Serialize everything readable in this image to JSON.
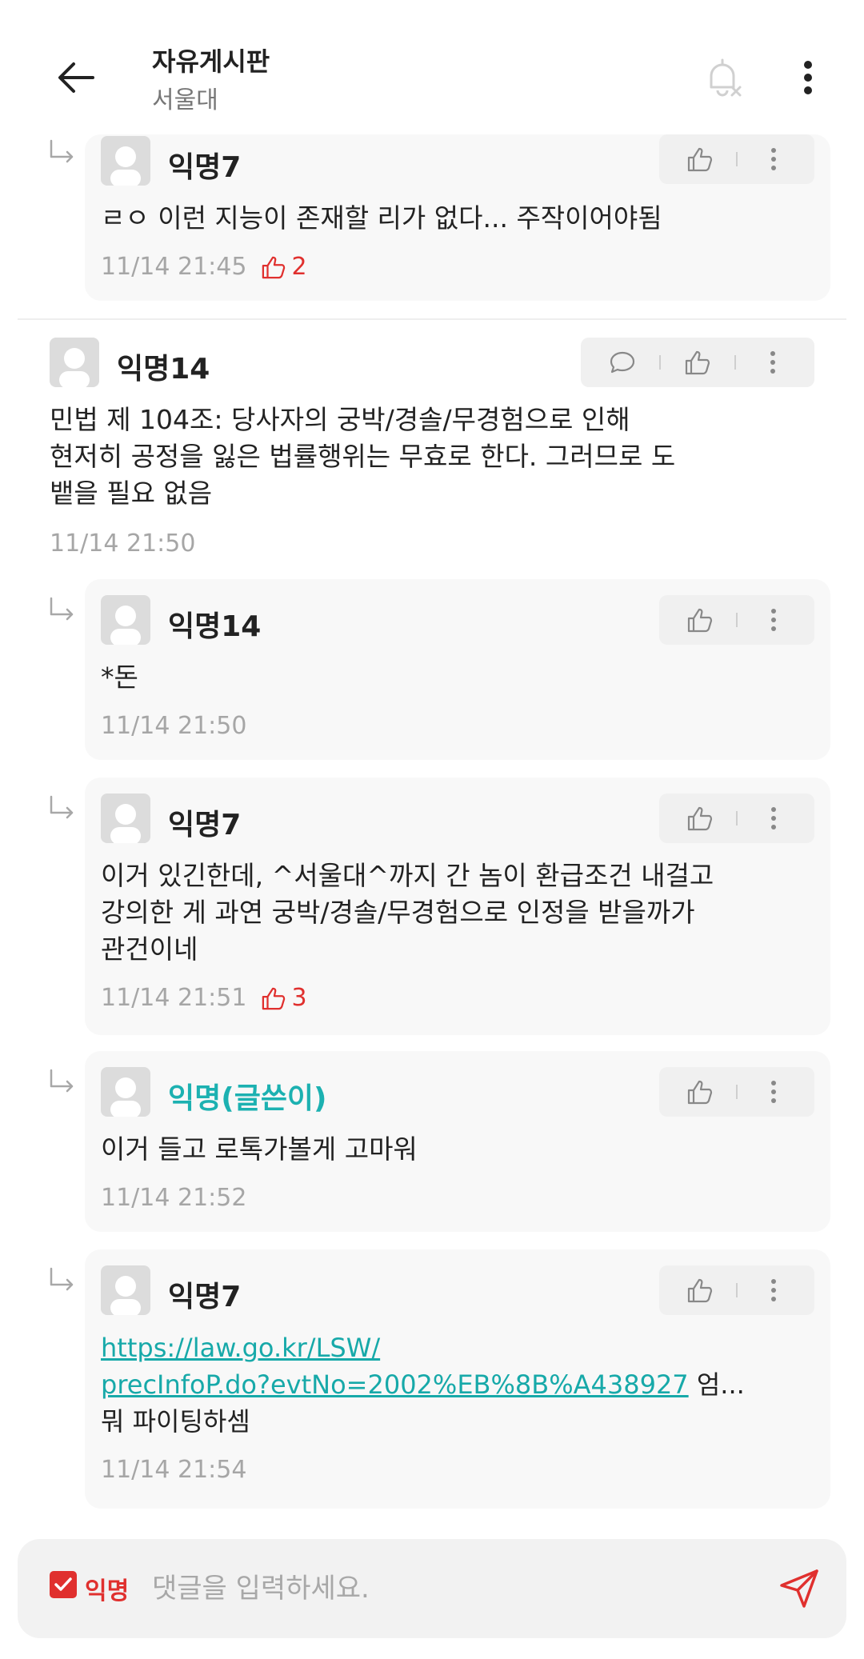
{
  "header": {
    "title": "자유게시판",
    "subtitle": "서울대"
  },
  "comments": [
    {
      "author": "익명7",
      "text": "ㄹㅇ 이런 지능이 존재할 리가 없다... 주작이어야됨",
      "time": "11/14 21:45",
      "likes": "2"
    },
    {
      "author": "익명14",
      "text_lines": [
        "민법 제 104조: 당사자의 궁박/경솔/무경험으로 인해",
        "현저히 공정을 잃은 법률행위는 무효로 한다. 그러므로 도",
        "뱉을 필요 없음"
      ],
      "time": "11/14 21:50"
    },
    {
      "author": "익명14",
      "text": "*돈",
      "time": "11/14 21:50"
    },
    {
      "author": "익명7",
      "text_lines": [
        "이거 있긴한데, ^서울대^까지 간 놈이 환급조건 내걸고",
        "강의한 게 과연 궁박/경솔/무경험으로 인정을 받을까가",
        "관건이네"
      ],
      "time": "11/14 21:51",
      "likes": "3"
    },
    {
      "author": "익명(글쓴이)",
      "text": "이거 들고 로톡가볼게 고마워",
      "time": "11/14 21:52"
    },
    {
      "author": "익명7",
      "link_line1": "https://law.go.kr/LSW/",
      "link_line2": "precInfoP.do?evtNo=2002%EB%8B%A438927",
      "after_link": " 엄...",
      "text_line3": "뭐 파이팅하셈",
      "time": "11/14 21:54"
    }
  ],
  "input_bar": {
    "anon_label": "익명",
    "placeholder": "댓글을 입력하세요."
  },
  "colors": {
    "accent_red": "#e0302e",
    "op_teal": "#1cb1b1"
  }
}
